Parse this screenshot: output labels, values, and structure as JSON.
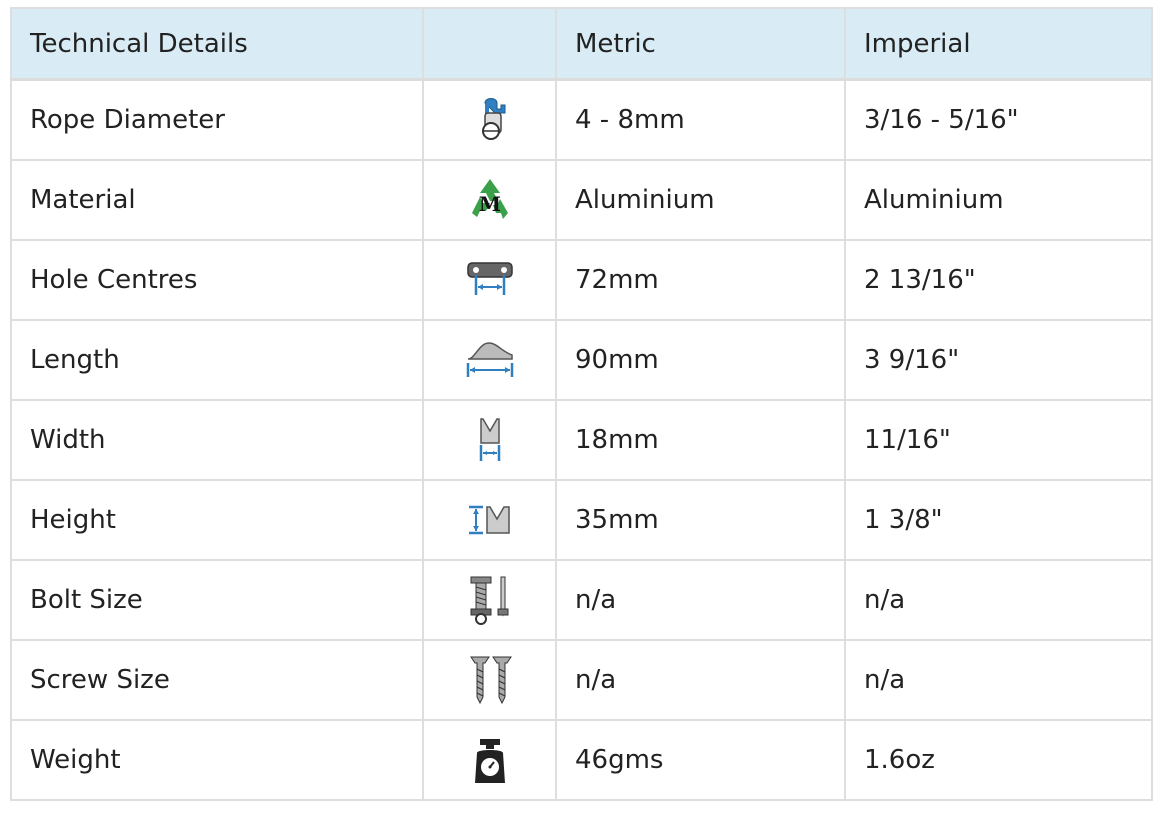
{
  "header": {
    "col1": "Technical Details",
    "col2": "",
    "col3": "Metric",
    "col4": "Imperial"
  },
  "rows": [
    {
      "label": "Rope Diameter",
      "icon": "rope-diameter-icon",
      "metric": "4 - 8mm",
      "imperial": "3/16 - 5/16\""
    },
    {
      "label": "Material",
      "icon": "recycle-material-icon",
      "metric": "Aluminium",
      "imperial": "Aluminium"
    },
    {
      "label": "Hole Centres",
      "icon": "hole-centres-icon",
      "metric": "72mm",
      "imperial": "2 13/16\""
    },
    {
      "label": "Length",
      "icon": "length-icon",
      "metric": "90mm",
      "imperial": "3 9/16\""
    },
    {
      "label": "Width",
      "icon": "width-icon",
      "metric": "18mm",
      "imperial": "11/16\""
    },
    {
      "label": "Height",
      "icon": "height-icon",
      "metric": "35mm",
      "imperial": "1 3/8\""
    },
    {
      "label": "Bolt Size",
      "icon": "bolt-icon",
      "metric": "n/a",
      "imperial": "n/a"
    },
    {
      "label": "Screw Size",
      "icon": "screw-icon",
      "metric": "n/a",
      "imperial": "n/a"
    },
    {
      "label": "Weight",
      "icon": "weight-icon",
      "metric": "46gms",
      "imperial": "1.6oz"
    }
  ],
  "colors": {
    "header_bg": "#d9ecf5",
    "border": "#dedede",
    "icon_blue": "#2f7fc1",
    "icon_green": "#3aa04a"
  }
}
